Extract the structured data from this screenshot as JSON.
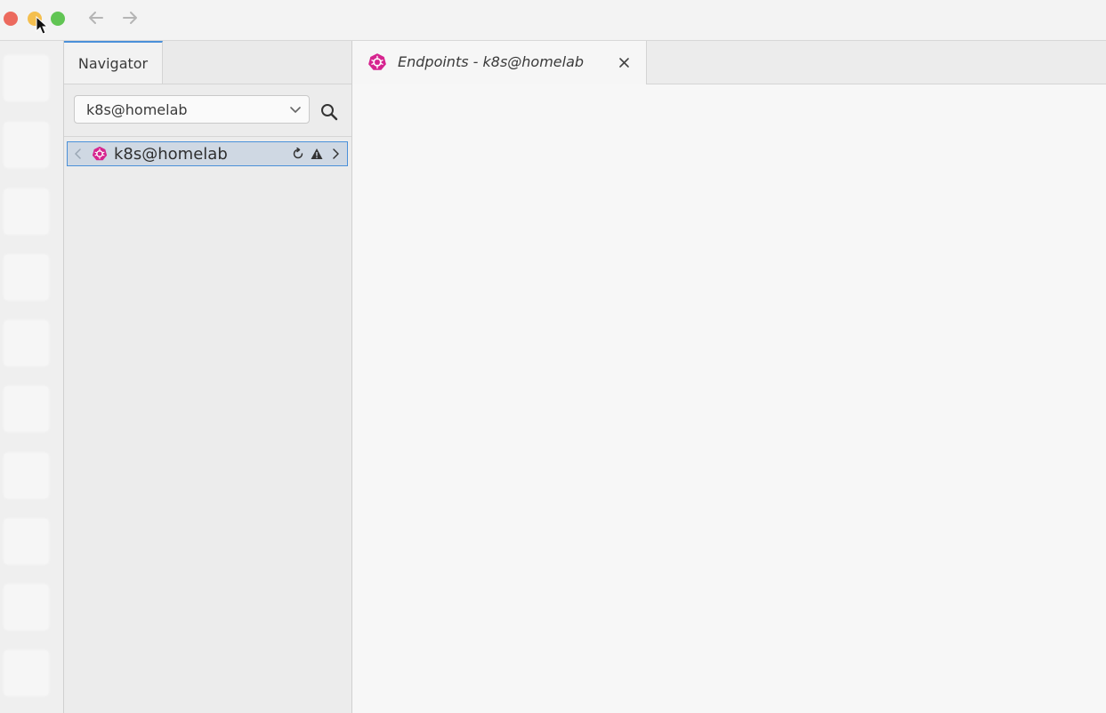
{
  "window": {
    "buttons": [
      "close",
      "minimize",
      "maximize"
    ],
    "nav": {
      "back_icon": "arrow-left-icon",
      "forward_icon": "arrow-right-icon"
    }
  },
  "hotbar": {
    "slot_count": 10
  },
  "sidebar": {
    "tab_label": "Navigator",
    "context_select": {
      "value": "k8s@homelab"
    },
    "tree": {
      "selected_item": {
        "label": "k8s@homelab",
        "icon": "kubernetes-icon"
      }
    }
  },
  "main": {
    "tabs": [
      {
        "title": "Endpoints - k8s@homelab",
        "icon": "kubernetes-icon"
      }
    ]
  },
  "colors": {
    "accent": "#4a90d9",
    "kubernetes_icon": "#d6248f",
    "close": "#ec6a5e",
    "minimize": "#f4bf4f",
    "maximize": "#61c554"
  }
}
